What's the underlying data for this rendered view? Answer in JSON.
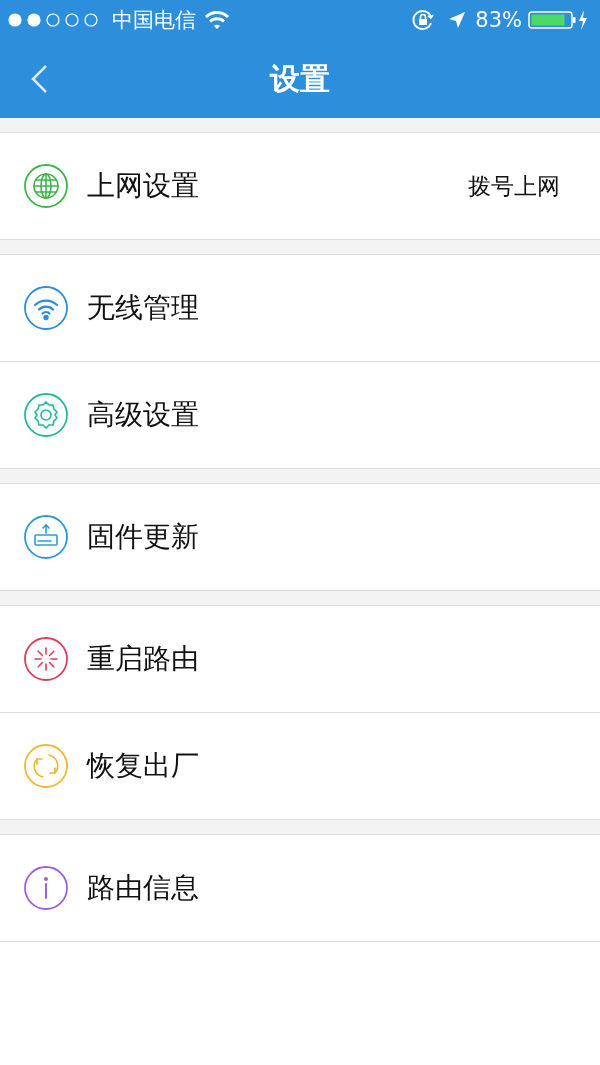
{
  "status_bar": {
    "carrier": "中国电信",
    "battery": "83%"
  },
  "nav": {
    "title": "设置"
  },
  "groups": [
    {
      "items": [
        {
          "kind": "globe",
          "label": "上网设置",
          "value": "拨号上网",
          "color": "#3cb54a"
        }
      ]
    },
    {
      "items": [
        {
          "kind": "wifi",
          "label": "无线管理",
          "color": "#2a8de0"
        },
        {
          "kind": "gear",
          "label": "高级设置",
          "color": "#26b89a"
        }
      ]
    },
    {
      "items": [
        {
          "kind": "upload",
          "label": "固件更新",
          "color": "#2c9bd6"
        }
      ]
    },
    {
      "items": [
        {
          "kind": "restart",
          "label": "重启路由",
          "color": "#d9405a"
        },
        {
          "kind": "reset",
          "label": "恢复出厂",
          "color": "#f2b631"
        }
      ]
    },
    {
      "items": [
        {
          "kind": "info",
          "label": "路由信息",
          "color": "#9a62e0"
        }
      ]
    }
  ]
}
